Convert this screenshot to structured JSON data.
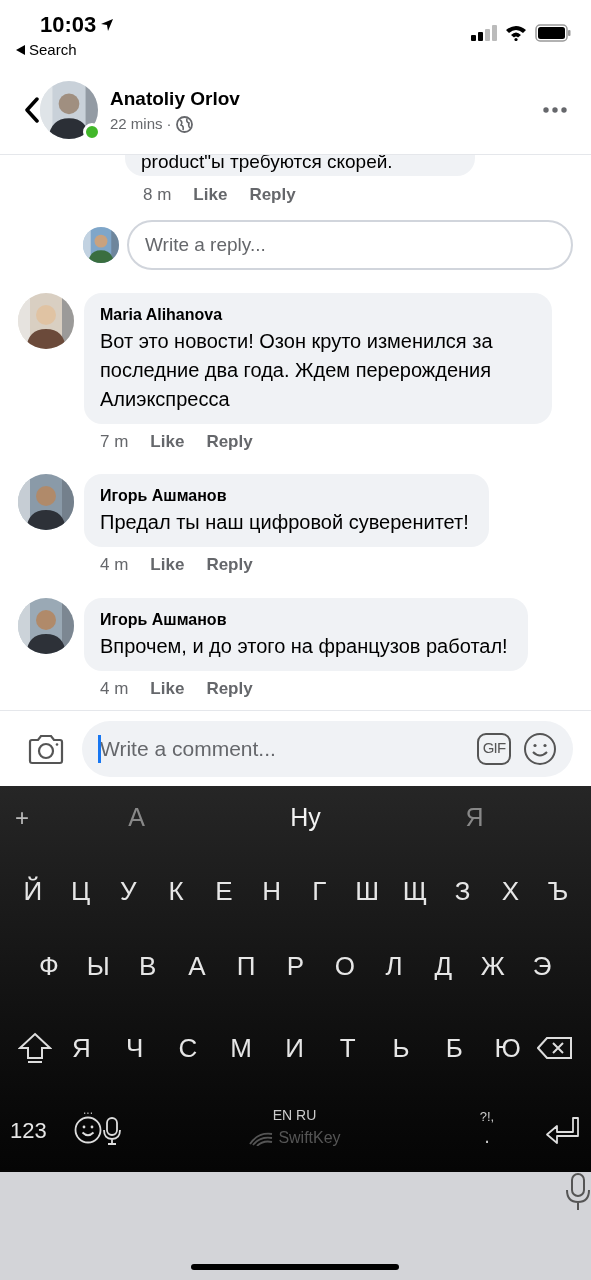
{
  "status_bar": {
    "time": "10:03",
    "back_label": "Search"
  },
  "header": {
    "name": "Anatoliy Orlov",
    "time": "22 mins",
    "separator": "·",
    "online": true
  },
  "partial_comment": {
    "text": "product\"ы требуются скорей.",
    "time": "8 m",
    "like": "Like",
    "reply": "Reply"
  },
  "reply_field": {
    "placeholder": "Write a reply..."
  },
  "comments": [
    {
      "author": "Maria Alihanova",
      "text": "Вот это новости! Озон круто изменился за последние два года. Ждем перерождения Алиэкспресса",
      "time": "7 m",
      "like": "Like",
      "reply": "Reply"
    },
    {
      "author": "Игорь Ашманов",
      "text": "Предал ты наш цифровой суверенитет!",
      "time": "4 m",
      "like": "Like",
      "reply": "Reply"
    },
    {
      "author": "Игорь Ашманов",
      "text": "Впрочем, и до этого на французов работал!",
      "time": "4 m",
      "like": "Like",
      "reply": "Reply"
    }
  ],
  "comment_bar": {
    "placeholder": "Write a comment...",
    "gif": "GIF"
  },
  "keyboard": {
    "plus": "+",
    "suggestions": [
      {
        "text": "А",
        "highlighted": false
      },
      {
        "text": "Ну",
        "highlighted": true
      },
      {
        "text": "Я",
        "highlighted": false
      }
    ],
    "rows": [
      [
        "Й",
        "Ц",
        "У",
        "К",
        "Е",
        "Н",
        "Г",
        "Ш",
        "Щ",
        "З",
        "Х",
        "Ъ"
      ],
      [
        "Ф",
        "Ы",
        "В",
        "А",
        "П",
        "Р",
        "О",
        "Л",
        "Д",
        "Ж",
        "Э"
      ],
      [
        "Я",
        "Ч",
        "С",
        "М",
        "И",
        "Т",
        "Ь",
        "Б",
        "Ю"
      ]
    ],
    "numbers_key": "123",
    "emoji_hint": "...",
    "languages": "EN RU",
    "brand": "SwiftKey",
    "punctuation_hint": "?!,",
    "period": "."
  }
}
